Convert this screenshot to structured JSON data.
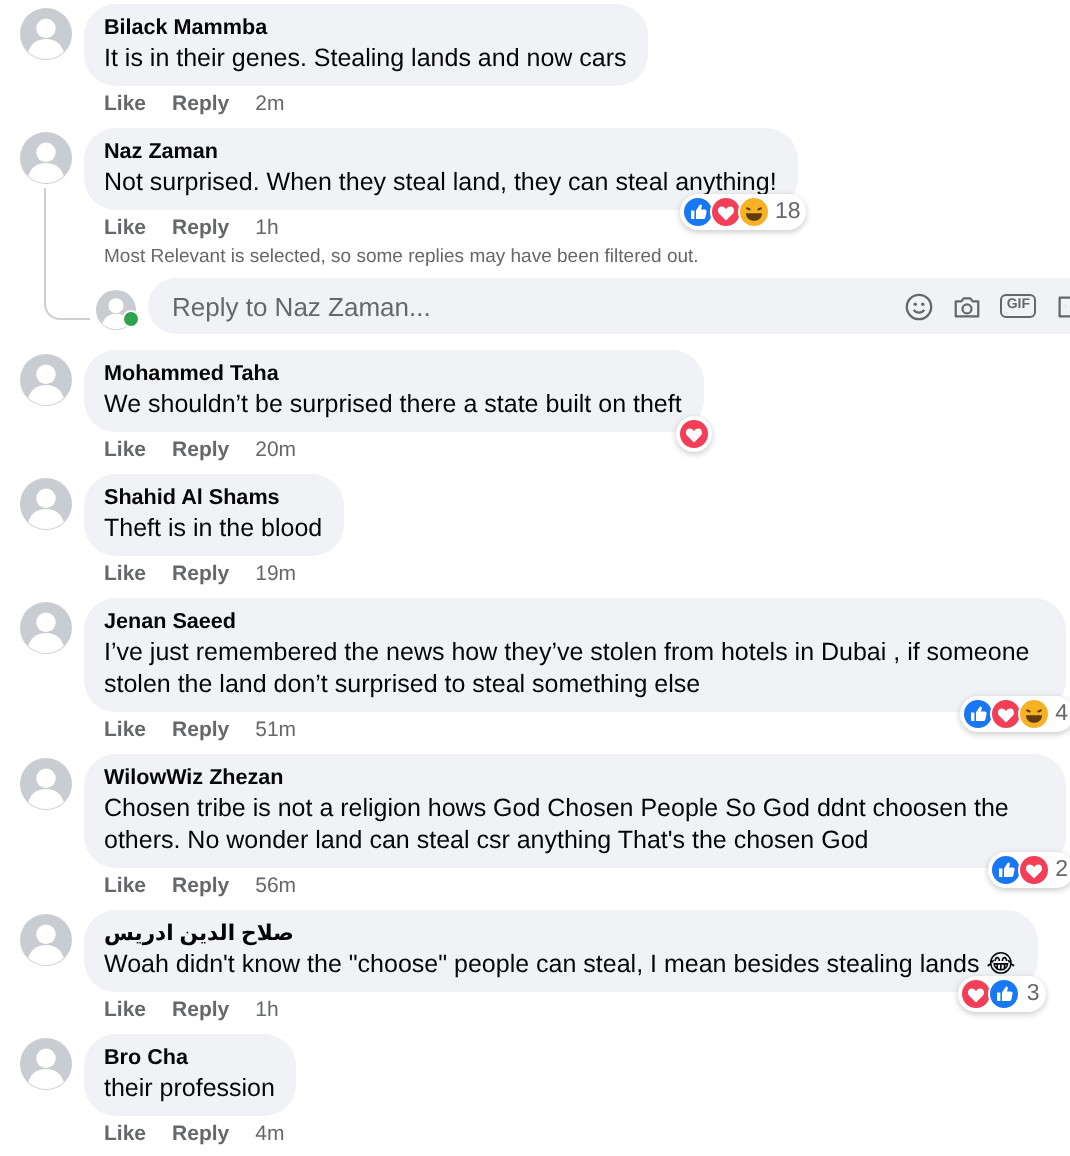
{
  "comments": [
    {
      "author": "Bilack Mammba",
      "text": "It is in their genes. Stealing lands and now cars",
      "actions": [
        "Like",
        "Reply"
      ],
      "time": "2m"
    },
    {
      "author": "Naz Zaman",
      "text": "Not surprised. When they steal land, they can steal anything!",
      "actions": [
        "Like",
        "Reply"
      ],
      "time": "1h",
      "reactions": {
        "icons": [
          {
            "kind": "like"
          },
          {
            "kind": "love"
          },
          {
            "kind": "haha"
          }
        ],
        "count": "18"
      },
      "note": "Most Relevant is selected, so some replies may have been filtered out.",
      "reply_box": {
        "placeholder": "Reply to Naz Zaman...",
        "online": true,
        "gif_label": "GIF"
      }
    },
    {
      "author": "Mohammed Taha",
      "text": "We shouldn’t be surprised there a state built on theft",
      "actions": [
        "Like",
        "Reply"
      ],
      "time": "20m",
      "reactions": {
        "icons": [
          {
            "kind": "love"
          }
        ]
      }
    },
    {
      "author": "Shahid Al Shams",
      "text": "Theft is in the blood",
      "actions": [
        "Like",
        "Reply"
      ],
      "time": "19m"
    },
    {
      "author": "Jenan Saeed",
      "text": "I’ve just remembered the news how they’ve stolen from hotels in Dubai , if someone stolen the land don’t surprised to steal something else",
      "actions": [
        "Like",
        "Reply"
      ],
      "time": "51m",
      "reactions": {
        "icons": [
          {
            "kind": "like"
          },
          {
            "kind": "love"
          },
          {
            "kind": "haha"
          }
        ],
        "count": "4"
      }
    },
    {
      "author": "WilowWiz Zhezan",
      "text": "Chosen tribe is not a religion hows God Chosen People So God ddnt choosen the others. No wonder land can steal csr anything That's the chosen God",
      "actions": [
        "Like",
        "Reply"
      ],
      "time": "56m",
      "reactions": {
        "icons": [
          {
            "kind": "like"
          },
          {
            "kind": "love"
          }
        ],
        "count": "2"
      }
    },
    {
      "author": "صلاح الدين ادريس",
      "text": "Woah didn't know the \"choose\" people can steal, I mean besides stealing lands 😂",
      "actions": [
        "Like",
        "Reply"
      ],
      "time": "1h",
      "reactions": {
        "icons": [
          {
            "kind": "love"
          },
          {
            "kind": "like"
          }
        ],
        "count": "3"
      }
    },
    {
      "author": "Bro Cha",
      "text": "their profession",
      "actions": [
        "Like",
        "Reply"
      ],
      "time": "4m"
    }
  ]
}
